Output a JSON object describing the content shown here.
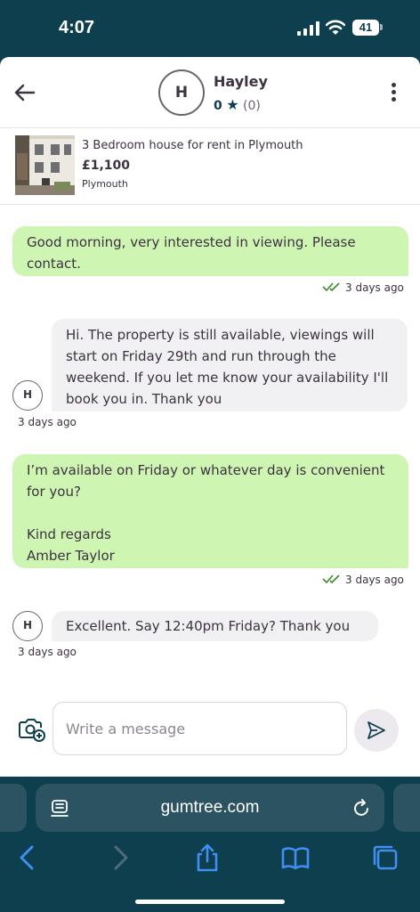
{
  "status": {
    "time": "4:07",
    "battery": "41"
  },
  "header": {
    "avatar_initial": "H",
    "name": "Hayley",
    "rating": "0",
    "rating_count": "(0)"
  },
  "listing": {
    "title": "3 Bedroom house for rent in Plymouth",
    "price": "£1,100",
    "location": "Plymouth"
  },
  "messages": [
    {
      "side": "sent",
      "text": "Good morning, very interested in viewing. Please contact.",
      "time": "3 days ago"
    },
    {
      "side": "received",
      "avatar": "H",
      "text": "Hi. The property is still available, viewings will start on Friday 29th and run through the weekend. If you let me know your availability I'll book you in. Thank you",
      "time": "3 days ago"
    },
    {
      "side": "sent",
      "text_lines": [
        "I’m available on Friday or whatever day is convenient for you?",
        "",
        "Kind regards",
        "Amber Taylor"
      ],
      "time": "3 days ago"
    },
    {
      "side": "received",
      "avatar": "H",
      "text": "Excellent. Say 12:40pm Friday? Thank you",
      "time": "3 days ago"
    }
  ],
  "composer": {
    "placeholder": "Write a message"
  },
  "browser": {
    "url": "gumtree.com"
  },
  "colors": {
    "brand_dark": "#0e3f4e",
    "sent_bubble": "#cff5b3",
    "received_bubble": "#f1f0f2",
    "tick_green": "#3c8a2e"
  }
}
